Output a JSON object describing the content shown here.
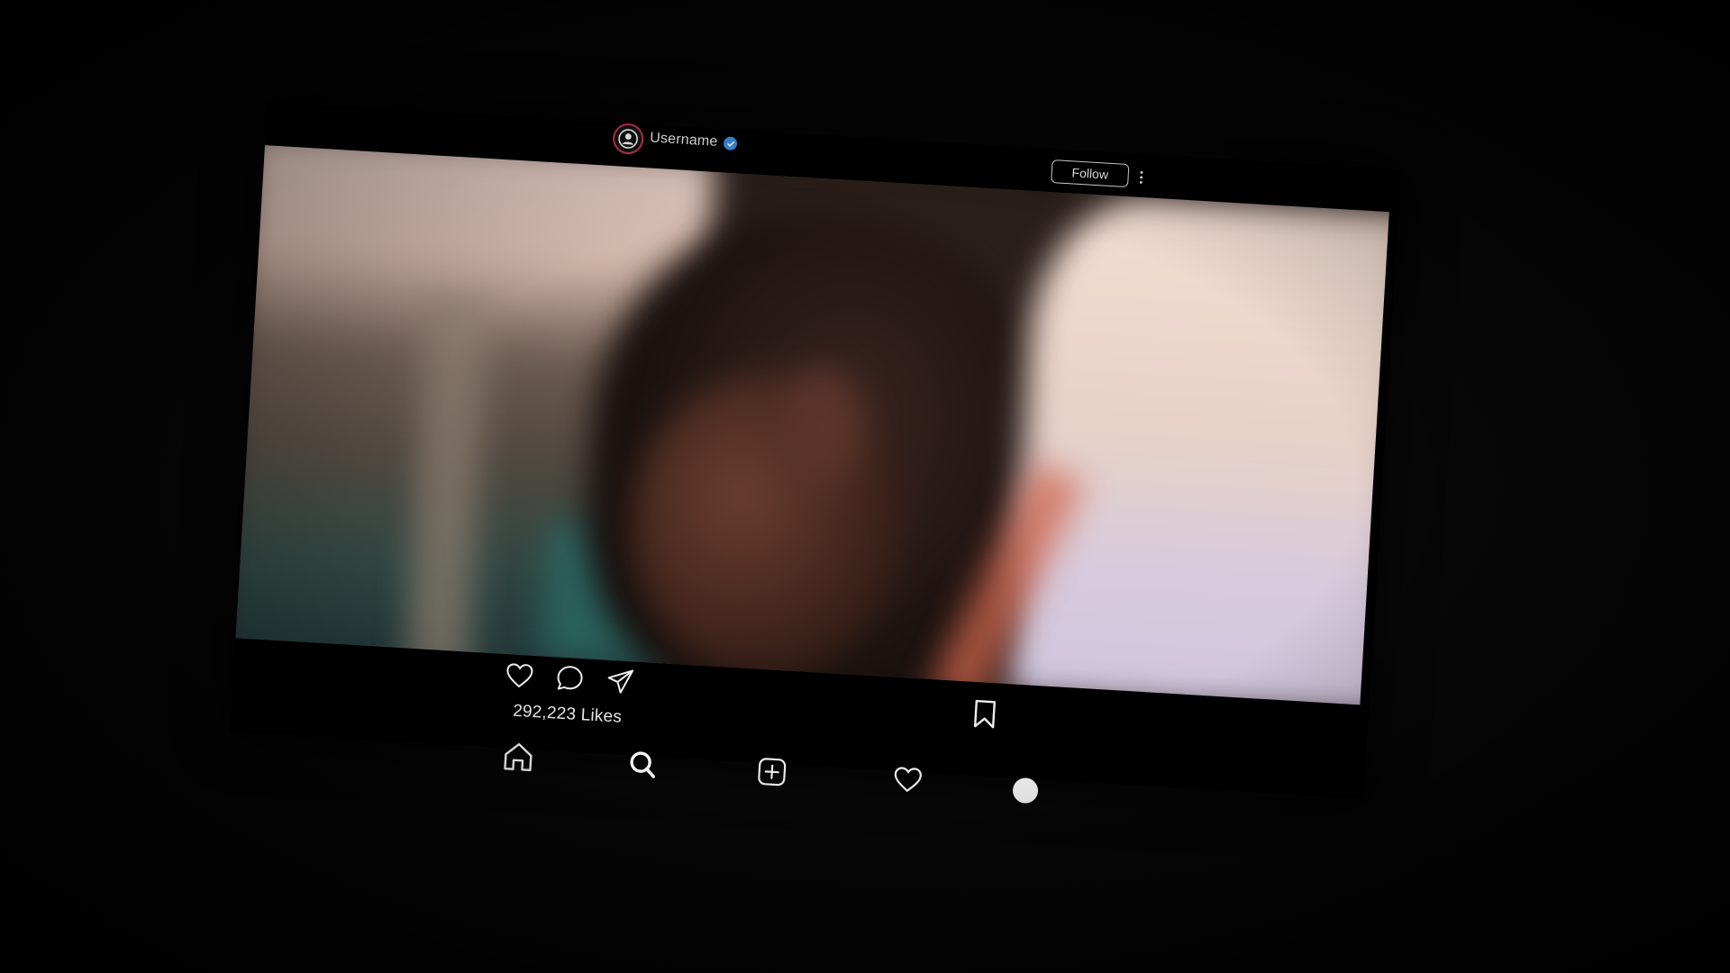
{
  "post": {
    "username": "Username",
    "verified": true,
    "follow_label": "Follow",
    "likes_text": "292,223 Likes"
  },
  "icons": {
    "avatar": "user-avatar-icon",
    "verified": "verified-badge-icon",
    "more": "more-options-icon",
    "like": "heart-icon",
    "comment": "comment-icon",
    "share": "send-icon",
    "save": "bookmark-icon"
  },
  "nav": {
    "items": [
      {
        "icon": "home-icon"
      },
      {
        "icon": "search-icon"
      },
      {
        "icon": "add-post-icon"
      },
      {
        "icon": "activity-heart-icon"
      },
      {
        "icon": "profile-icon"
      }
    ]
  },
  "colors": {
    "background": "#000000",
    "foreground": "#e9e9e9",
    "avatar_ring": "#c8325a",
    "verified_blue": "#3b8fe0"
  }
}
